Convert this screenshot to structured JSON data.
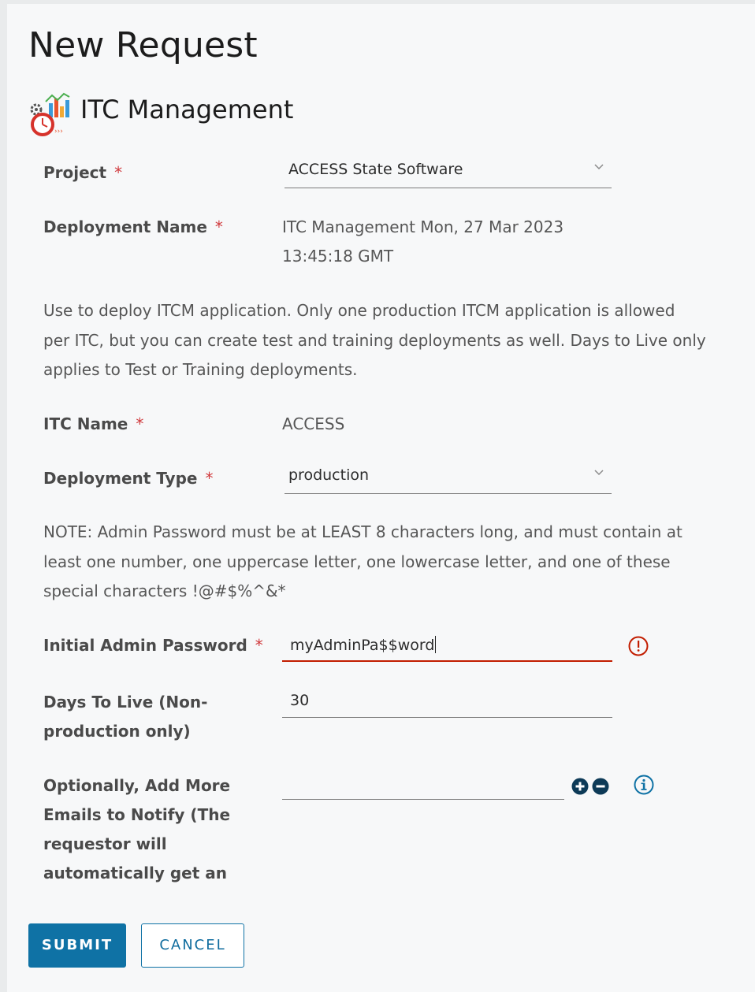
{
  "page": {
    "title": "New Request"
  },
  "catalog": {
    "name": "ITC Management",
    "icon": "itc-management-icon"
  },
  "required_marker": "*",
  "form": {
    "project": {
      "label": "Project",
      "value": "ACCESS State Software"
    },
    "deployment_name": {
      "label": "Deployment Name",
      "value_line1": "ITC Management Mon, 27 Mar 2023",
      "value_line2": "13:45:18 GMT"
    },
    "description": {
      "line1": "Use to deploy ITCM application. Only one production ITCM application is allowed",
      "line2": "per ITC, but you can create test and training deployments as well. Days to Live only",
      "line3": "applies to Test or Training deployments."
    },
    "itc_name": {
      "label": "ITC Name",
      "value": "ACCESS"
    },
    "deployment_type": {
      "label": "Deployment Type",
      "value": "production"
    },
    "note": {
      "line1": "NOTE: Admin Password must be at LEAST 8 characters long, and must contain at",
      "line2": "least one number, one uppercase letter, one lowercase letter, and one of these",
      "line3": "special characters !@#$%^&*"
    },
    "admin_password": {
      "label": "Initial Admin Password",
      "value": "myAdminPa$$word",
      "status": "error"
    },
    "days_to_live": {
      "label_line1": "Days To Live (Non-",
      "label_line2": "production only)",
      "value": "30"
    },
    "emails": {
      "label_line1": "Optionally, Add More",
      "label_line2": "Emails to Notify (The",
      "label_line3": "requestor will",
      "label_line4": "automatically get an",
      "value": ""
    }
  },
  "actions": {
    "submit": "SUBMIT",
    "cancel": "CANCEL"
  },
  "colors": {
    "accent": "#0f72a5",
    "error": "#c21d00",
    "required": "#d0393c"
  }
}
